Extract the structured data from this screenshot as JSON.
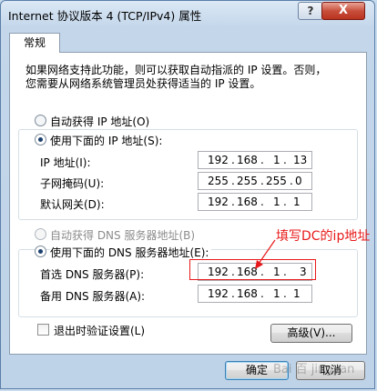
{
  "window": {
    "title": "Internet 协议版本 4 (TCP/IPv4) 属性",
    "help_label": "?",
    "close_label": "X"
  },
  "tabs": [
    {
      "label": "常规"
    }
  ],
  "general": {
    "description_line1": "如果网络支持此功能，则可以获取自动指派的 IP 设置。否则，",
    "description_line2": "您需要从网络系统管理员处获得适当的 IP 设置。",
    "ip_auto_label": "自动获得 IP 地址(O)",
    "ip_manual_label": "使用下面的 IP 地址(S):",
    "ip_mode": "manual",
    "ip_address_label": "IP 地址(I):",
    "ip_address": [
      "192",
      "168",
      "1",
      "13"
    ],
    "subnet_label": "子网掩码(U):",
    "subnet_mask": [
      "255",
      "255",
      "255",
      "0"
    ],
    "gateway_label": "默认网关(D):",
    "default_gateway": [
      "192",
      "168",
      "1",
      "1"
    ],
    "dns_auto_label": "自动获得 DNS 服务器地址(B)",
    "dns_manual_label": "使用下面的 DNS 服务器地址(E):",
    "dns_mode": "manual",
    "preferred_dns_label": "首选 DNS 服务器(P):",
    "preferred_dns": [
      "192",
      "168",
      "1",
      "3"
    ],
    "alternate_dns_label": "备用 DNS 服务器(A):",
    "alternate_dns": [
      "192",
      "168",
      "1",
      "1"
    ],
    "validate_label": "退出时验证设置(L)",
    "validate_checked": false,
    "advanced_label": "高级(V)..."
  },
  "footer": {
    "ok_label": "确定",
    "cancel_label": "取消"
  },
  "annotation": {
    "text": "填写DC的ip地址",
    "color": "#e8191a"
  },
  "watermark": {
    "text": "Bai 百 jingyan"
  }
}
